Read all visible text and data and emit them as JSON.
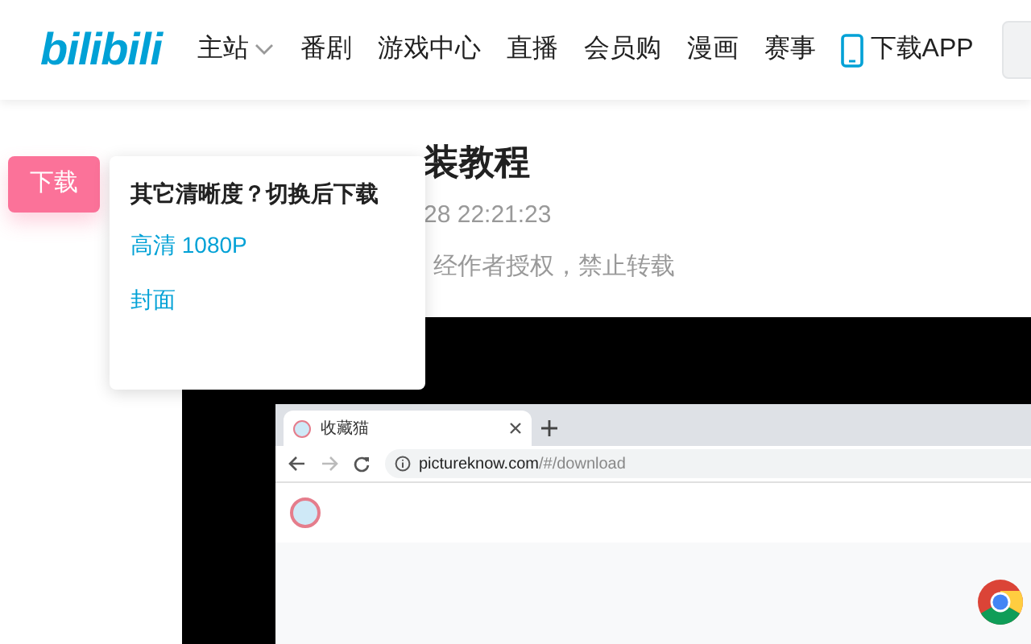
{
  "header": {
    "logo": "bilibili",
    "nav": [
      {
        "label": "主站",
        "kind": "dropdown"
      },
      {
        "label": "番剧",
        "kind": "link"
      },
      {
        "label": "游戏中心",
        "kind": "link"
      },
      {
        "label": "直播",
        "kind": "link"
      },
      {
        "label": "会员购",
        "kind": "link"
      },
      {
        "label": "漫画",
        "kind": "link"
      },
      {
        "label": "赛事",
        "kind": "link"
      },
      {
        "label": "下载APP",
        "kind": "app"
      }
    ]
  },
  "download_button": "下载",
  "popup": {
    "heading": "其它清晰度？切换后下载",
    "options": [
      "高清 1080P",
      "封面"
    ]
  },
  "article": {
    "title": "装教程",
    "date": "28 22:21:23",
    "notice": "经作者授权，禁止转载"
  },
  "video": {
    "browser": {
      "tab_title": "收藏猫",
      "url_host": "pictureknow.com",
      "url_path": "/#/download"
    }
  }
}
